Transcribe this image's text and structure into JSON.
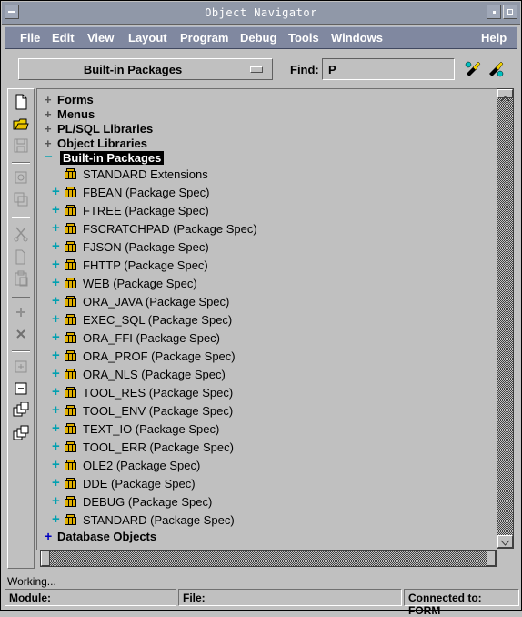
{
  "window": {
    "title": "Object Navigator"
  },
  "menu": [
    "File",
    "Edit",
    "View",
    "Layout",
    "Program",
    "Debug",
    "Tools",
    "Windows",
    "Help"
  ],
  "toolbar": {
    "combo_value": "Built-in Packages",
    "find_label": "Find:",
    "find_value": "P"
  },
  "tree": {
    "top_nodes": [
      {
        "label": "Forms",
        "expander": "+"
      },
      {
        "label": "Menus",
        "expander": "+"
      },
      {
        "label": "PL/SQL Libraries",
        "expander": "+"
      },
      {
        "label": "Object Libraries",
        "expander": "+"
      },
      {
        "label": "Built-in Packages",
        "expander": "−",
        "selected": true
      }
    ],
    "standard_extensions": "STANDARD Extensions",
    "packages": [
      "FBEAN (Package Spec)",
      "FTREE (Package Spec)",
      "FSCRATCHPAD (Package Spec)",
      "FJSON (Package Spec)",
      "FHTTP (Package Spec)",
      "WEB (Package Spec)",
      "ORA_JAVA (Package Spec)",
      "EXEC_SQL (Package Spec)",
      "ORA_FFI (Package Spec)",
      "ORA_PROF (Package Spec)",
      "ORA_NLS (Package Spec)",
      "TOOL_RES (Package Spec)",
      "TOOL_ENV (Package Spec)",
      "TEXT_IO (Package Spec)",
      "TOOL_ERR (Package Spec)",
      "OLE2 (Package Spec)",
      "DDE (Package Spec)",
      "DEBUG (Package Spec)",
      "STANDARD (Package Spec)"
    ],
    "database_objects": "Database Objects"
  },
  "status": {
    "message": "Working...",
    "module_label": "Module:",
    "file_label": "File:",
    "connection": "Connected to: FORM"
  },
  "colors": {
    "menubar": "#8088a0",
    "titlebar": "#9098a8",
    "expander_cyan": "#00a0b0",
    "expander_blue": "#0000c0",
    "package_icon": "#e0b000"
  }
}
